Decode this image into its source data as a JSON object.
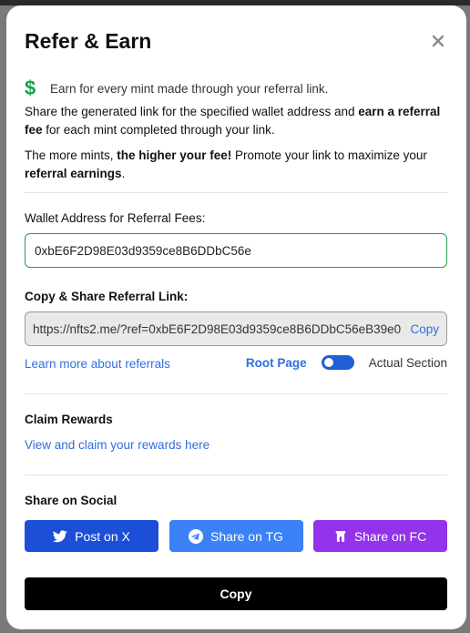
{
  "modal": {
    "title": "Refer & Earn",
    "earn_icon": "$",
    "earn_text": "Earn for every mint made through your referral link.",
    "p1": {
      "a": "Share the generated link for the specified wallet address and ",
      "b": "earn a referral fee",
      "c": " for each mint completed through your link."
    },
    "p2": {
      "a": "The more mints, ",
      "b": "the higher your fee!",
      "c": " Promote your link to maximize your ",
      "d": "referral earnings",
      "e": "."
    }
  },
  "wallet": {
    "label": "Wallet Address for Referral Fees:",
    "value": "0xbE6F2D98E03d9359ce8B6DDbC56e"
  },
  "referral": {
    "label": "Copy & Share Referral Link:",
    "link": "https://nfts2.me/?ref=0xbE6F2D98E03d9359ce8B6DDbC56eB39e0",
    "copy_label": "Copy",
    "learn_more": "Learn more about referrals",
    "root_page": "Root Page",
    "actual_section": "Actual Section",
    "toggle_on": true
  },
  "claim": {
    "title": "Claim Rewards",
    "link": "View and claim your rewards here"
  },
  "social": {
    "title": "Share on Social",
    "x_label": "Post on X",
    "tg_label": "Share on TG",
    "fc_label": "Share on FC"
  },
  "footer": {
    "copy_label": "Copy"
  },
  "colors": {
    "accent": "#2f6fde",
    "success": "#16a34a",
    "x": "#1d4ed8",
    "tg": "#3b82f6",
    "fc": "#9333ea"
  }
}
